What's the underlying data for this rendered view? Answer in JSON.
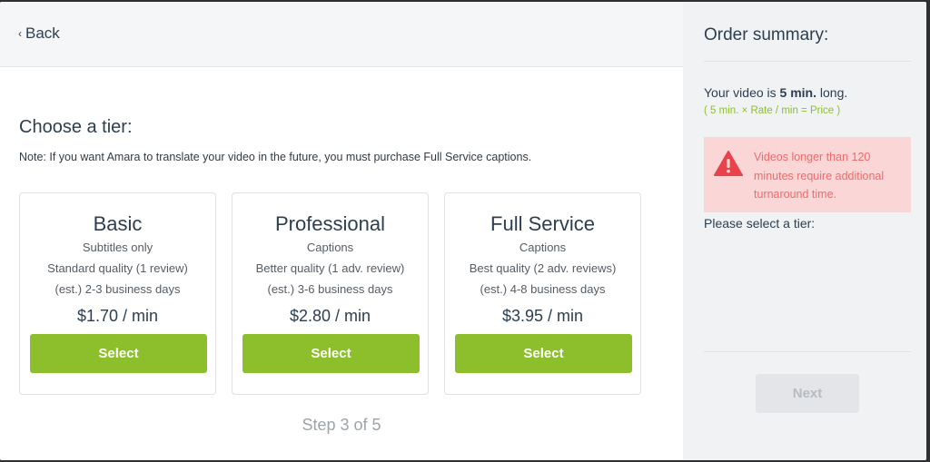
{
  "nav": {
    "back_chevron": "‹",
    "back_label": "Back"
  },
  "main": {
    "heading": "Choose a tier:",
    "note": "Note: If you want Amara to translate your video in the future, you must purchase Full Service captions.",
    "tiers": [
      {
        "name": "Basic",
        "subtitle": "Subtitles only",
        "quality": "Standard quality (1 review)",
        "turnaround": "(est.) 2-3 business days",
        "price": "$1.70 / min",
        "button": "Select"
      },
      {
        "name": "Professional",
        "subtitle": "Captions",
        "quality": "Better quality (1 adv. review)",
        "turnaround": "(est.) 3-6 business days",
        "price": "$2.80 / min",
        "button": "Select"
      },
      {
        "name": "Full Service",
        "subtitle": "Captions",
        "quality": "Best quality (2 adv. reviews)",
        "turnaround": "(est.) 4-8 business days",
        "price": "$3.95 / min",
        "button": "Select"
      }
    ],
    "step": "Step 3 of 5"
  },
  "summary": {
    "title": "Order summary:",
    "video_prefix": "Your video is ",
    "video_length": "5 min.",
    "video_suffix": " long.",
    "formula": "( 5 min. × Rate / min = Price )",
    "alert_icon": "warning-icon",
    "alert": "Videos longer than 120 minutes require additional turnaround time.",
    "prompt": "Please select a tier:",
    "next_label": "Next",
    "next_disabled": true
  },
  "colors": {
    "accent_green": "#8dbf2c",
    "alert_bg": "#fbd6d6",
    "alert_text": "#ee6b6b",
    "alert_icon": "#e8434a",
    "heading_text": "#2d3e50"
  }
}
